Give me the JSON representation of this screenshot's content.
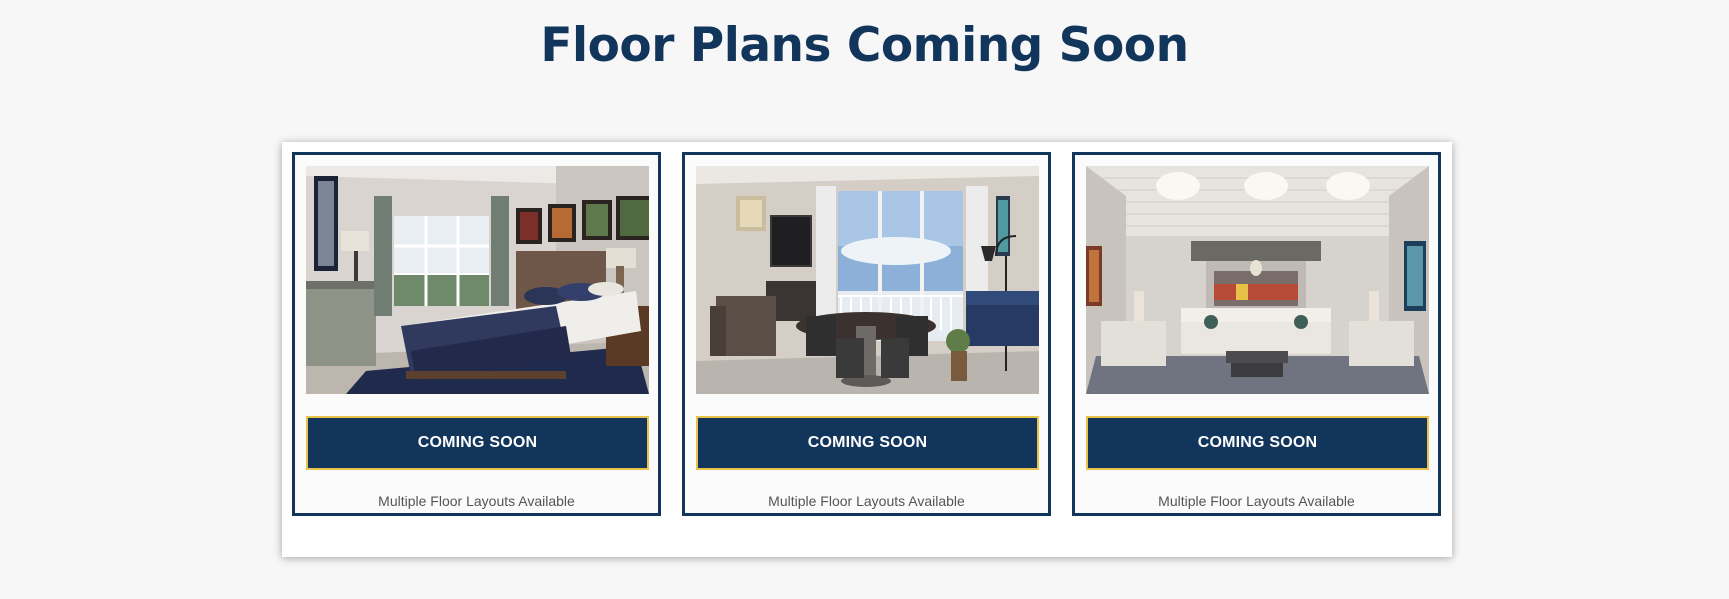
{
  "page": {
    "title": "Floor Plans Coming Soon"
  },
  "colors": {
    "navy": "#12355b",
    "gold_border": "#e8c24a",
    "background": "#f7f7f7",
    "caption": "#555555"
  },
  "cards": [
    {
      "image": "bedroom-photo",
      "button_label": "COMING SOON",
      "caption": "Multiple Floor Layouts Available"
    },
    {
      "image": "dining-room-photo",
      "button_label": "COMING SOON",
      "caption": "Multiple Floor Layouts Available"
    },
    {
      "image": "living-room-photo",
      "button_label": "COMING SOON",
      "caption": "Multiple Floor Layouts Available"
    }
  ]
}
